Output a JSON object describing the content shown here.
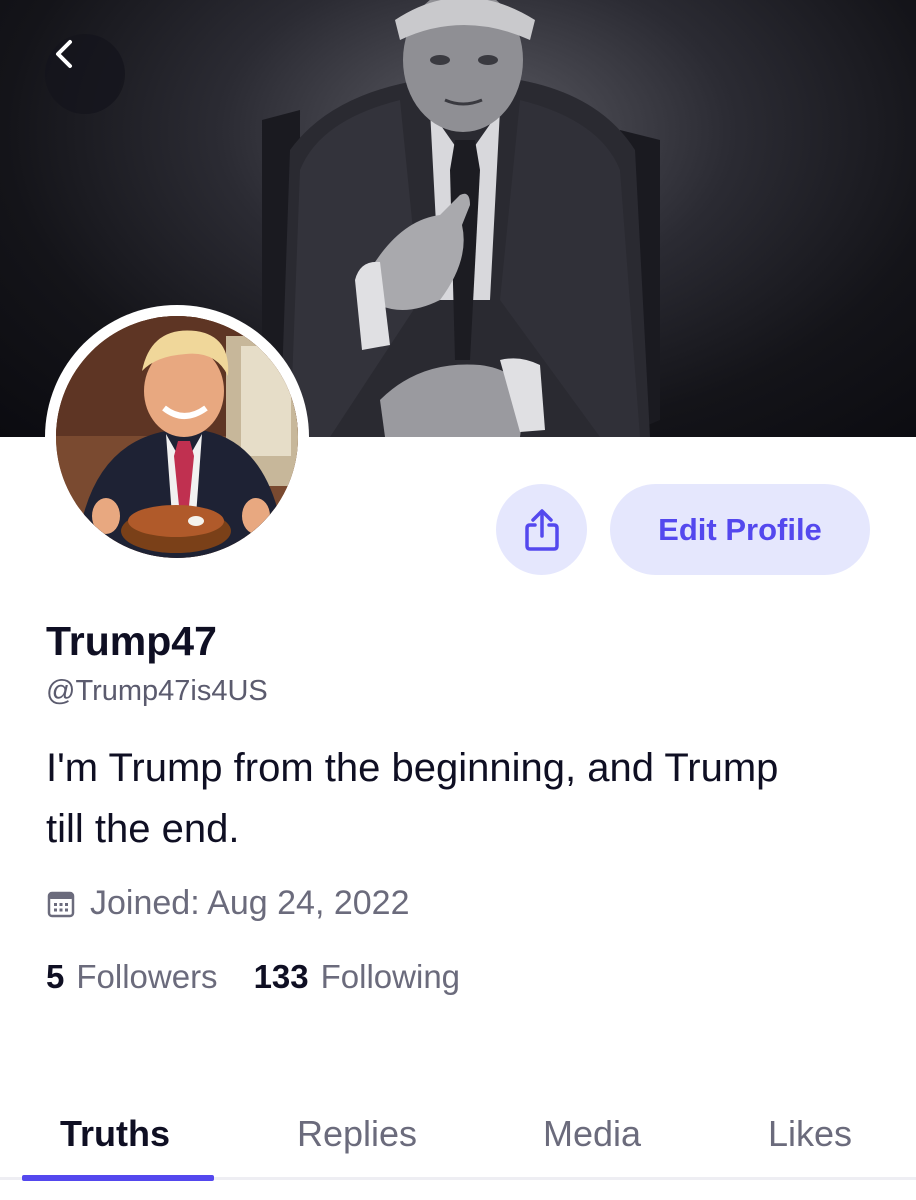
{
  "header": {
    "back_icon": "chevron-left-icon",
    "banner_image": "Photo of man in dark suit pointing at camera"
  },
  "avatar": {
    "image": "Photo of smiling man in suit at table with taco bowl"
  },
  "actions": {
    "share_icon": "share-icon",
    "edit_profile_label": "Edit Profile"
  },
  "profile": {
    "display_name": "Trump47",
    "handle": "@Trump47is4US",
    "bio": "I'm Trump from the beginning, and Trump till the end.",
    "joined_icon": "calendar-icon",
    "joined_text": "Joined: Aug 24, 2022"
  },
  "stats": {
    "followers_count": "5",
    "followers_label": "Followers",
    "following_count": "133",
    "following_label": "Following"
  },
  "tabs": [
    {
      "label": "Truths",
      "active": true
    },
    {
      "label": "Replies",
      "active": false
    },
    {
      "label": "Media",
      "active": false
    },
    {
      "label": "Likes",
      "active": false
    }
  ],
  "colors": {
    "accent": "#5448ee",
    "button_bg": "#e5e7fd",
    "text_primary": "#0f0f23",
    "text_secondary": "#6b6b7c"
  }
}
